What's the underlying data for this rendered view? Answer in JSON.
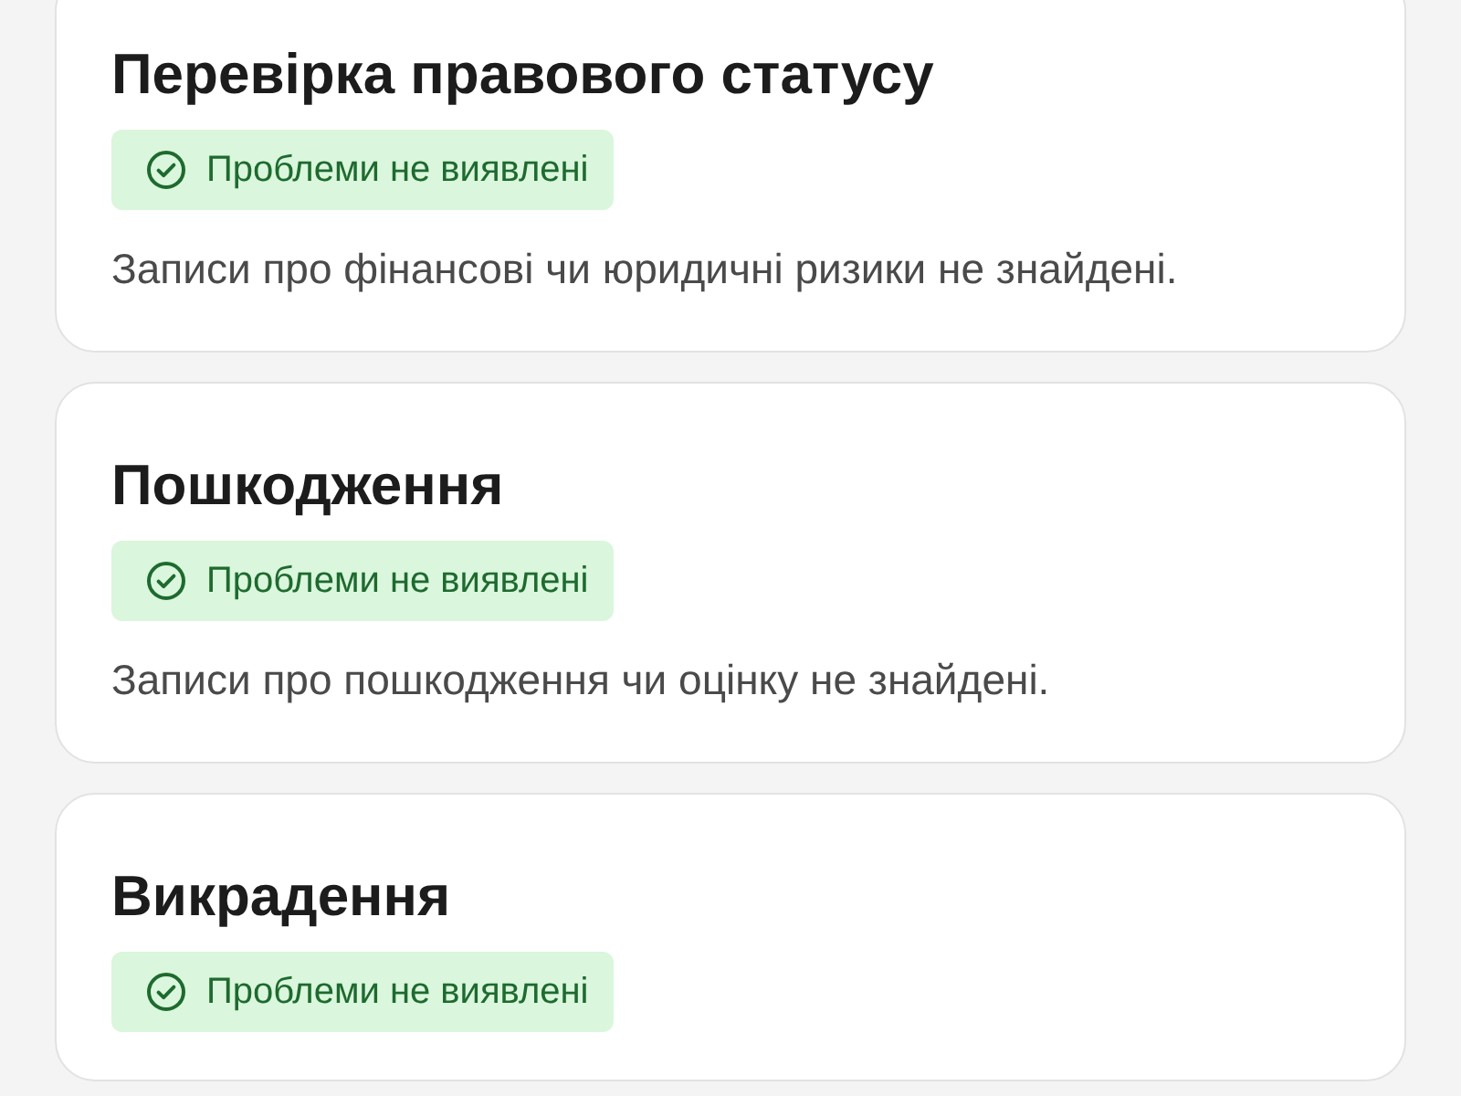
{
  "checks": [
    {
      "title": "Перевірка правового статусу",
      "status": {
        "kind": "ok",
        "label": "Проблеми не виявлені"
      },
      "description": "Записи про фінансові чи юридичні ризики не знайдені."
    },
    {
      "title": "Пошкодження",
      "status": {
        "kind": "ok",
        "label": "Проблеми не виявлені"
      },
      "description": "Записи про пошкодження чи оцінку не знайдені."
    },
    {
      "title": "Викрадення",
      "status": {
        "kind": "ok",
        "label": "Проблеми не виявлені"
      }
    }
  ]
}
